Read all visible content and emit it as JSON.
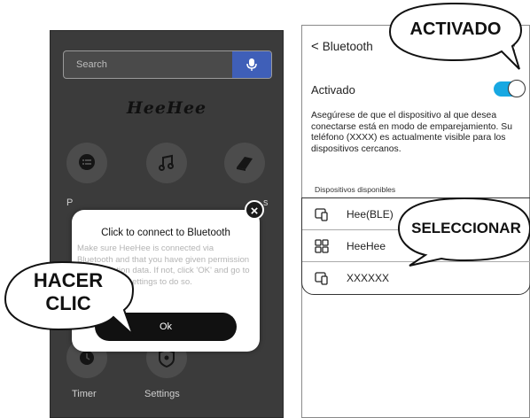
{
  "left_screen": {
    "search": {
      "placeholder": "Search"
    },
    "mic_icon": "microphone-icon",
    "logo": "HeeHee",
    "grid": [
      {
        "icon": "chat-icon",
        "label": "P"
      },
      {
        "icon": "music-note-icon",
        "label": ""
      },
      {
        "icon": "book-icon",
        "label": ""
      },
      {
        "icon": "timer-icon",
        "label": "Timer"
      },
      {
        "icon": "settings-icon",
        "label": "Settings"
      }
    ],
    "grid_partial_right_label": "s",
    "dialog": {
      "title": "Click to connect to Bluetooth",
      "body": "Make sure HeeHee is connected via Bluetooth and that you have given permission to the location data. If not, click 'OK' and go to your phone's settings to do so.",
      "ok_label": "Ok",
      "close_icon": "close-icon"
    },
    "callout": {
      "line1": "HACER",
      "line2": "CLIC"
    }
  },
  "right_screen": {
    "back_icon": "chevron-left-icon",
    "title": "Bluetooth",
    "menu_icon": "kebab-menu-icon",
    "toggle": {
      "label": "Activado",
      "state": "on",
      "color": "#18a8e2"
    },
    "description": "Asegúrese de que el dispositivo al que desea conectarse está en modo de emparejamiento. Su teléfono (XXXX) es actualmente visible para los dispositivos cercanos.",
    "section_label": "Dispositivos disponibles",
    "devices": [
      {
        "name": "Hee(BLE)",
        "icon": "phone-device-icon"
      },
      {
        "name": "HeeHee",
        "icon": "grid-device-icon"
      },
      {
        "name": "XXXXXX",
        "icon": "phone-device-icon"
      }
    ],
    "callout_activado": "ACTIVADO",
    "callout_seleccionar": "SELECCIONAR"
  }
}
